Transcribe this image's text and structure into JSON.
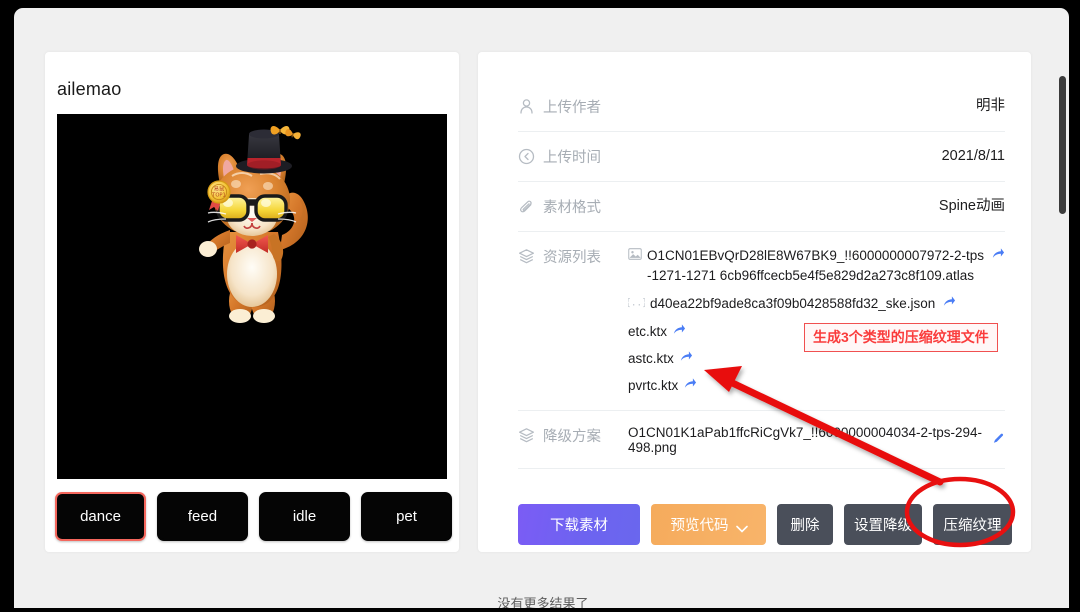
{
  "asset": {
    "title": "ailemao",
    "animations": [
      {
        "label": "dance",
        "selected": true
      },
      {
        "label": "feed",
        "selected": false
      },
      {
        "label": "idle",
        "selected": false
      },
      {
        "label": "pet",
        "selected": false
      }
    ]
  },
  "details": {
    "rows": [
      {
        "icon": "user-icon",
        "label": "上传作者",
        "value": "明非"
      },
      {
        "icon": "clock-back-icon",
        "label": "上传时间",
        "value": "2021/8/11"
      },
      {
        "icon": "paperclip-icon",
        "label": "素材格式",
        "value": "Spine动画"
      }
    ],
    "resource_list": {
      "icon": "layers-icon",
      "label": "资源列表",
      "files": [
        {
          "type": "image",
          "name": "O1CN01EBvQrD28lE8W67BK9_!!6000000007972-2-tps-1271-1271 6cb96ffcecb5e4f5e829d2a273c8f109.atlas",
          "has_link": true
        },
        {
          "type": "json",
          "name": "d40ea22bf9ade8ca3f09b0428588fd32_ske.json",
          "has_link": true
        },
        {
          "type": "ktx",
          "name": "etc.ktx",
          "has_link": true
        },
        {
          "type": "ktx",
          "name": "astc.ktx",
          "has_link": true
        },
        {
          "type": "ktx",
          "name": "pvrtc.ktx",
          "has_link": true
        }
      ]
    },
    "degrade": {
      "icon": "layers-icon",
      "label": "降级方案",
      "value": "O1CN01K1aPab1ffcRiCgVk7_!!6000000004034-2-tps-294-498.png"
    }
  },
  "annotation": {
    "callout_text": "生成3个类型的压缩纹理文件",
    "callout_color": "#fa3c3c",
    "arrow_color": "#e81010",
    "circle_target": "压缩纹理"
  },
  "actions": [
    {
      "name": "download",
      "label": "下载素材",
      "style": "purple"
    },
    {
      "name": "preview-code",
      "label": "预览代码",
      "style": "orange",
      "has_chevron": true
    },
    {
      "name": "delete",
      "label": "删除",
      "style": "dark"
    },
    {
      "name": "set-degrade",
      "label": "设置降级",
      "style": "dark"
    },
    {
      "name": "compress-texture",
      "label": "压缩纹理",
      "style": "dark",
      "highlighted": true
    }
  ],
  "footer": {
    "note": "没有更多结果了"
  },
  "colors": {
    "page_bg": "#f0f0f0",
    "card_bg": "#ffffff",
    "label_gray": "#a7adb4",
    "link_blue": "#4a7df5",
    "accent_purple": "#6d63f0",
    "accent_orange": "#f5ab5c",
    "dark_btn": "#4a4f5a",
    "selected_border": "#f4675d"
  }
}
